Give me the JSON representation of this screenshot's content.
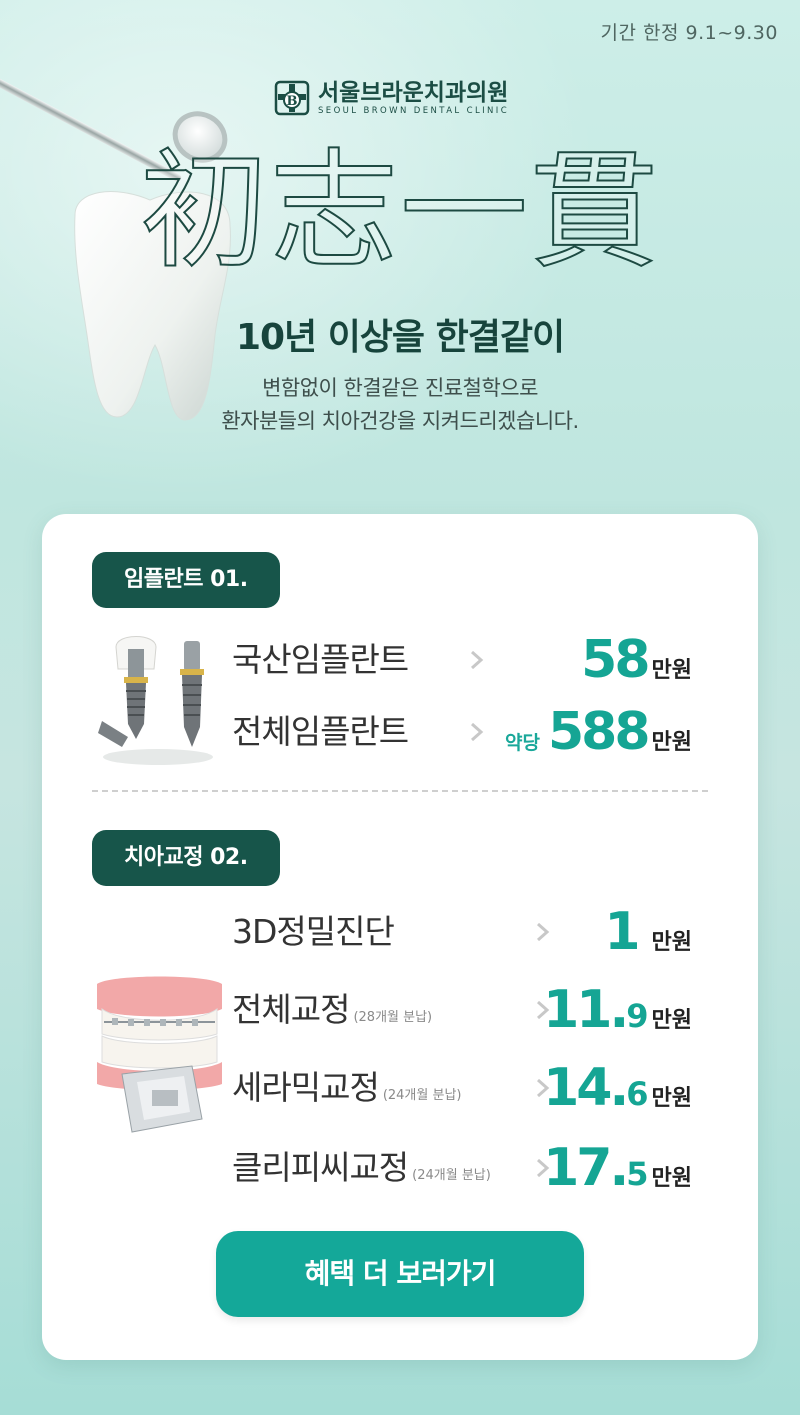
{
  "period": "기간 한정 9.1~9.30",
  "logo": {
    "korean": "서울브라운치과의원",
    "english": "SEOUL BROWN DENTAL CLINIC"
  },
  "hero": {
    "hanja": "初志一貫",
    "headline": "10년 이상을 한결같이",
    "desc_line1": "변함없이 한결같은 진료철학으로",
    "desc_line2": "환자분들의 치아건강을 지켜드리겠습니다."
  },
  "implant": {
    "badge": "임플란트 01.",
    "items": [
      {
        "name": "국산임플란트",
        "prefix": "",
        "price": "58",
        "decimal": "",
        "unit": "만원"
      },
      {
        "name": "전체임플란트",
        "prefix": "약당",
        "price": "588",
        "decimal": "",
        "unit": "만원"
      }
    ]
  },
  "ortho": {
    "badge": "치아교정 02.",
    "items": [
      {
        "name": "3D정밀진단",
        "note": "",
        "price": "1",
        "decimal": "",
        "unit": "만원"
      },
      {
        "name": "전체교정",
        "note": "(28개월 분납)",
        "price": "11.",
        "decimal": "9",
        "unit": "만원"
      },
      {
        "name": "세라믹교정",
        "note": "(24개월 분납)",
        "price": "14.",
        "decimal": "6",
        "unit": "만원"
      },
      {
        "name": "클리피씨교정",
        "note": "(24개월 분납)",
        "price": "17.",
        "decimal": "5",
        "unit": "만원"
      }
    ]
  },
  "cta": "혜택 더 보러가기",
  "colors": {
    "brand_dark": "#17554a",
    "accent": "#15a594",
    "cta": "#14a899",
    "background": "#bfe6df"
  }
}
